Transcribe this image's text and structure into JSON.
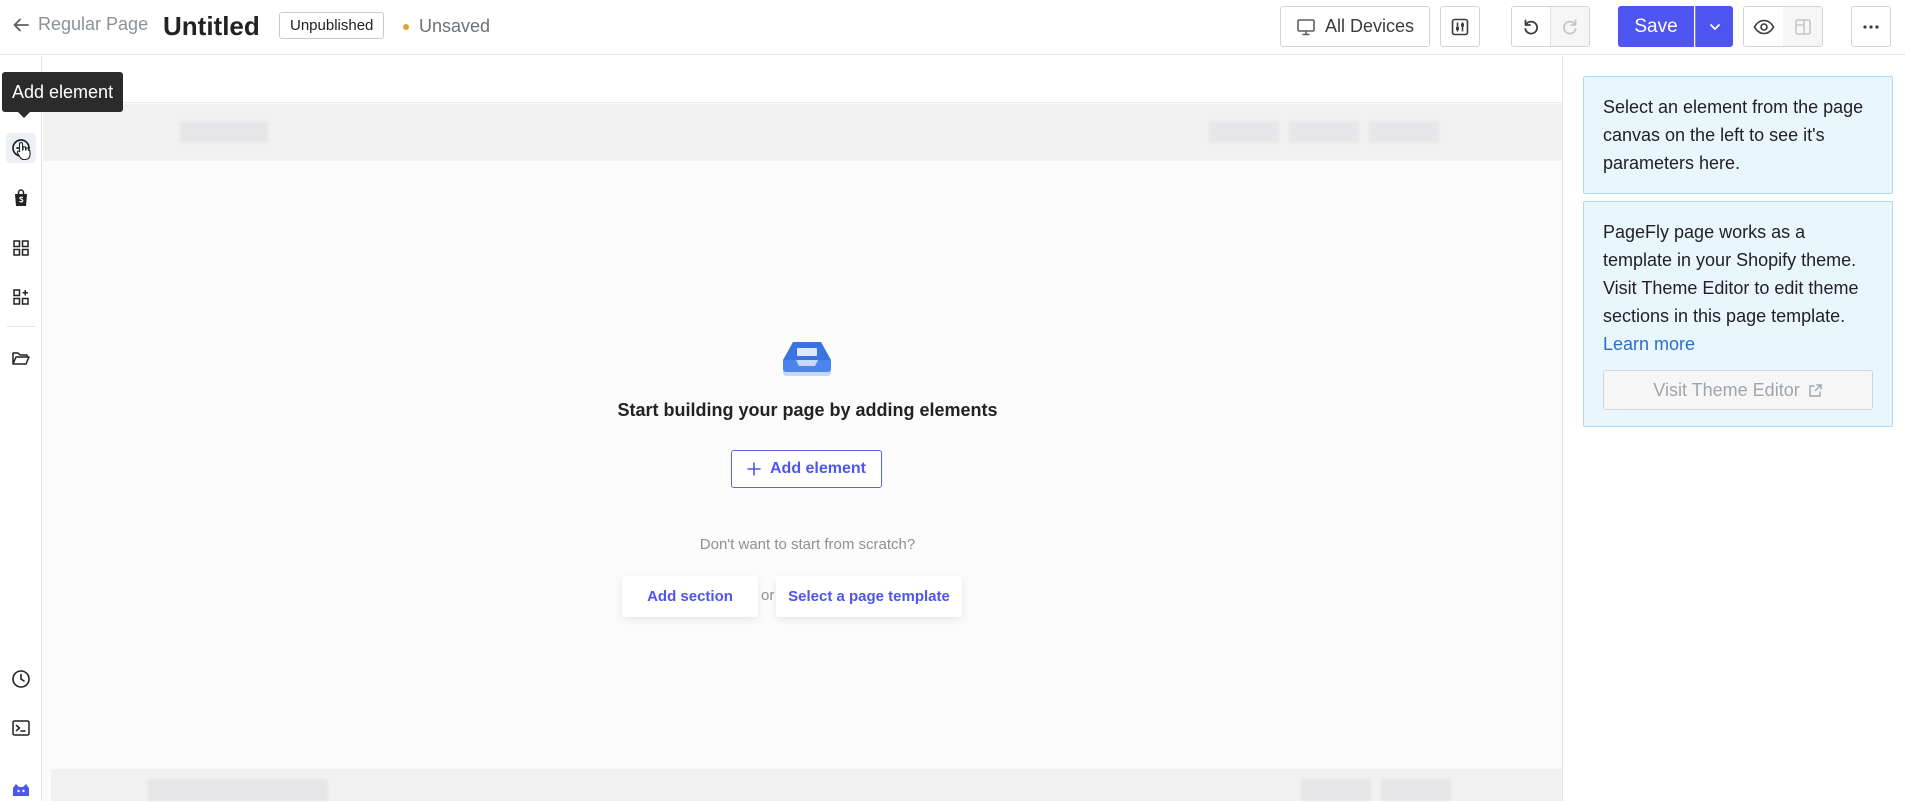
{
  "topbar": {
    "back_label": "Regular Page",
    "page_title": "Untitled",
    "status": "Unpublished",
    "save_state": "Unsaved",
    "devices_label": "All Devices",
    "save_label": "Save"
  },
  "rail": {
    "tooltip": "Add element",
    "items": [
      "add-element",
      "shopify",
      "grid",
      "apps",
      "folder",
      "history",
      "terminal",
      "avatar"
    ]
  },
  "canvas": {
    "empty_title": "Start building your page by adding elements",
    "add_element_label": "Add element",
    "scratch_text": "Don't want to start from scratch?",
    "add_section_label": "Add section",
    "or_label": "or",
    "template_label": "Select a page template"
  },
  "panel": {
    "select_hint": "Select an element from the page canvas on the left to see it's parameters here.",
    "theme_note": "PageFly page works as a template in your Shopify theme. Visit Theme Editor to edit theme sections in this page template.",
    "learn_more": "Learn more",
    "visit_theme_label": "Visit Theme Editor"
  },
  "colors": {
    "accent": "#4e55f0",
    "info_bg": "#eaf6fd",
    "info_border": "#a8dcf5",
    "unsaved_dot": "#e0a13a"
  }
}
